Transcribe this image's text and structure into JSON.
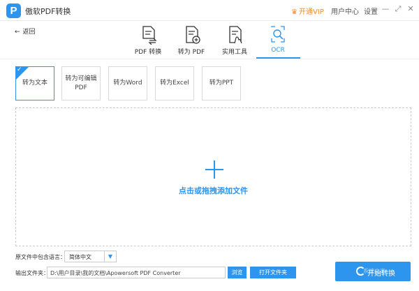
{
  "app": {
    "logo_letter": "P",
    "title": "傲软PDF转换"
  },
  "titlebar": {
    "vip_label": "开通VIP",
    "user_center": "用户中心",
    "settings": "设置",
    "min": "—",
    "max": "⤢",
    "close": "✕"
  },
  "nav": {
    "back_label": "返回"
  },
  "tabs": [
    {
      "label": "PDF 转换"
    },
    {
      "label": "转为 PDF"
    },
    {
      "label": "实用工具"
    },
    {
      "label": "OCR"
    }
  ],
  "options": [
    {
      "label": "转为文本"
    },
    {
      "label": "转为可编辑PDF"
    },
    {
      "label": "转为Word"
    },
    {
      "label": "转为Excel"
    },
    {
      "label": "转为PPT"
    }
  ],
  "dropzone": {
    "text": "点击或拖拽添加文件"
  },
  "language": {
    "label": "原文件中包含语言：",
    "value": "简体中文"
  },
  "output": {
    "label": "输出文件夹：",
    "path": "D:\\用户目录\\我的文档\\Apowersoft PDF Converter",
    "browse": "浏览",
    "open_folder": "打开文件夹"
  },
  "start_button": "开始转换",
  "watermark": "系统之家",
  "colors": {
    "accent": "#2e95ee",
    "vip": "#f48a1d"
  }
}
